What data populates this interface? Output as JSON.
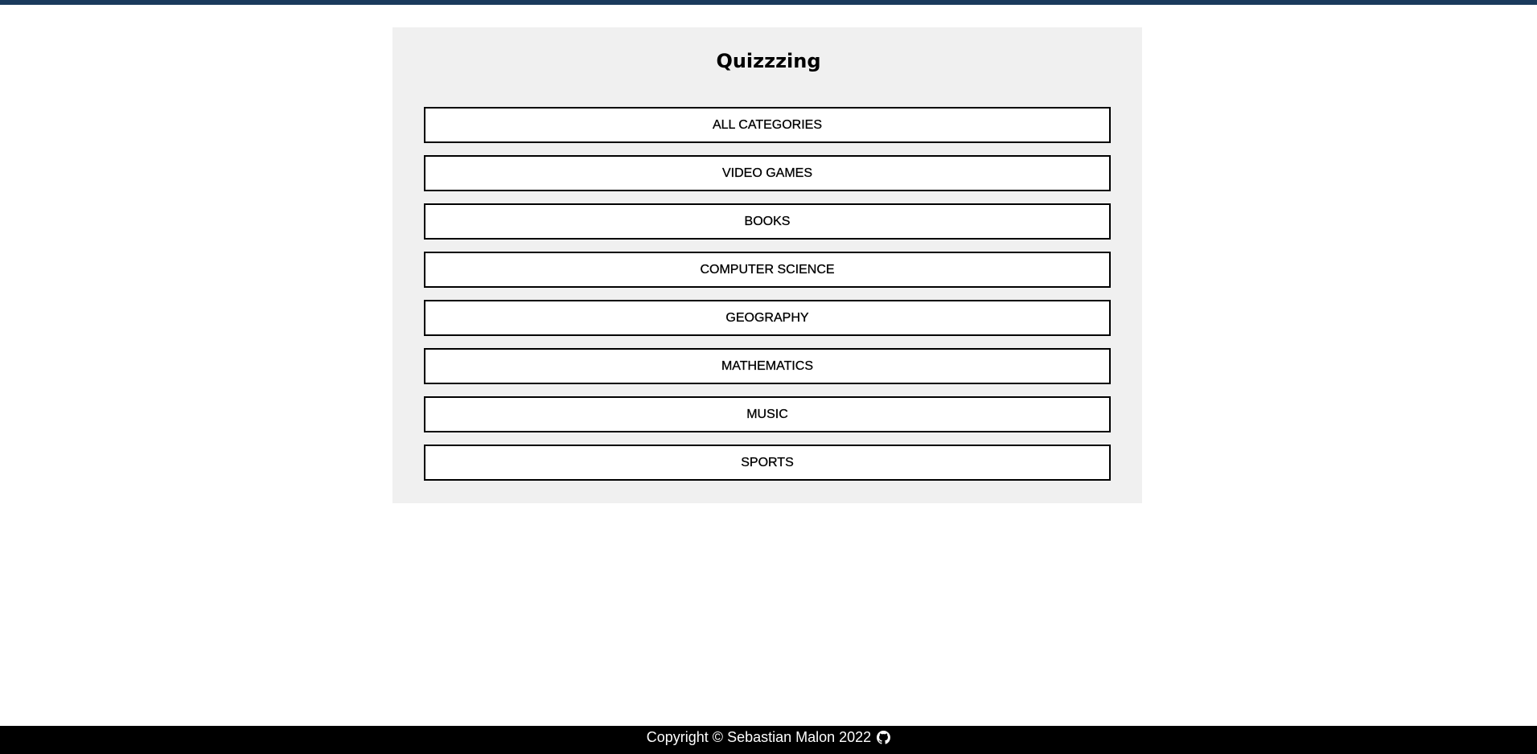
{
  "colors": {
    "top_bar": "#1a3a5c",
    "panel": "#f0f0f0",
    "footer_bg": "#000000",
    "footer_text": "#ffffff"
  },
  "app": {
    "title": "Quizzzing"
  },
  "categories": [
    {
      "label": "ALL CATEGORIES"
    },
    {
      "label": "VIDEO GAMES"
    },
    {
      "label": "BOOKS"
    },
    {
      "label": "COMPUTER SCIENCE"
    },
    {
      "label": "GEOGRAPHY"
    },
    {
      "label": "MATHEMATICS"
    },
    {
      "label": "MUSIC"
    },
    {
      "label": "SPORTS"
    }
  ],
  "footer": {
    "text": "Copyright © Sebastian Malon 2022",
    "icon": "github-icon"
  }
}
